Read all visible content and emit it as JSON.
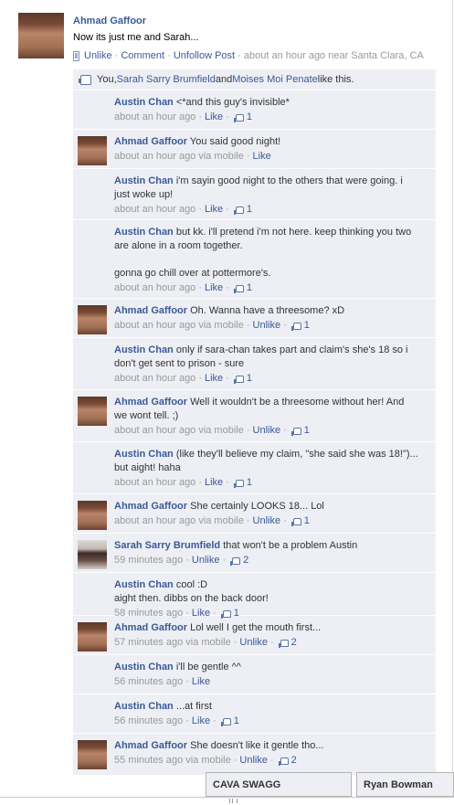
{
  "post": {
    "author": "Ahmad Gaffoor",
    "text": "Now its just me and Sarah...",
    "actions": {
      "unlike": "Unlike",
      "comment": "Comment",
      "unfollow": "Unfollow Post",
      "time": "about an hour ago near Santa Clara, CA"
    }
  },
  "likes": {
    "prefix": "You, ",
    "person1": "Sarah Sarry Brumfield",
    "and": " and ",
    "person2": "Moises Moi Penate",
    "suffix": " like this."
  },
  "comments": [
    {
      "author": "Austin Chan",
      "text": "<*and this guy's invisible*",
      "time": "about an hour ago",
      "via": "",
      "action": "Like",
      "likes": "1",
      "avatar": "none"
    },
    {
      "author": "Ahmad Gaffoor",
      "text": "You said good night!",
      "time": "about an hour ago",
      "via": "via mobile",
      "action": "Like",
      "likes": "",
      "avatar": "ahmad"
    },
    {
      "author": "Austin Chan",
      "text": "i'm sayin good night to the others that were going. i just woke up!",
      "time": "about an hour ago",
      "via": "",
      "action": "Like",
      "likes": "1",
      "avatar": "none"
    },
    {
      "author": "Austin Chan",
      "text": "but kk. i'll pretend i'm not here. keep thinking you two are alone in a room together.\n\ngonna go chill over at pottermore's.",
      "time": "about an hour ago",
      "via": "",
      "action": "Like",
      "likes": "1",
      "avatar": "none"
    },
    {
      "author": "Ahmad Gaffoor",
      "text": "Oh. Wanna have a threesome? xD",
      "time": "about an hour ago",
      "via": "via mobile",
      "action": "Unlike",
      "likes": "1",
      "avatar": "ahmad"
    },
    {
      "author": "Austin Chan",
      "text": "only if sara-chan takes part and claim's she's 18 so i don't get sent to prison - sure",
      "time": "about an hour ago",
      "via": "",
      "action": "Like",
      "likes": "1",
      "avatar": "none"
    },
    {
      "author": "Ahmad Gaffoor",
      "text": "Well it wouldn't be a threesome without her! And we wont tell. ;)",
      "time": "about an hour ago",
      "via": "via mobile",
      "action": "Unlike",
      "likes": "1",
      "avatar": "ahmad"
    },
    {
      "author": "Austin Chan",
      "text": "(like they'll believe my claim, \"she said she was 18!\")... but aight! haha",
      "time": "about an hour ago",
      "via": "",
      "action": "Like",
      "likes": "1",
      "avatar": "none"
    },
    {
      "author": "Ahmad Gaffoor",
      "text": "She certainly LOOKS 18... Lol",
      "time": "about an hour ago",
      "via": "via mobile",
      "action": "Unlike",
      "likes": "1",
      "avatar": "ahmad"
    },
    {
      "author": "Sarah Sarry Brumfield",
      "text": "that won't be a problem Austin",
      "time": "59 minutes ago",
      "via": "",
      "action": "Unlike",
      "likes": "2",
      "avatar": "sarah"
    },
    {
      "author": "Austin Chan",
      "text": "cool :D\naight then. dibbs on the back door!",
      "time": "58 minutes ago",
      "via": "",
      "action": "Like",
      "likes": "1",
      "avatar": "none"
    },
    {
      "author": "Ahmad Gaffoor",
      "text": "Lol well I get the mouth first...",
      "time": "57 minutes ago",
      "via": "via mobile",
      "action": "Unlike",
      "likes": "2",
      "avatar": "ahmad"
    },
    {
      "author": "Austin Chan",
      "text": "i'll be gentle ^^",
      "time": "56 minutes ago",
      "via": "",
      "action": "Like",
      "likes": "",
      "avatar": "none"
    },
    {
      "author": "Austin Chan",
      "text": "...at first",
      "time": "56 minutes ago",
      "via": "",
      "action": "Like",
      "likes": "1",
      "avatar": "none"
    },
    {
      "author": "Ahmad Gaffoor",
      "text": "She doesn't like it gentle tho...",
      "time": "55 minutes ago",
      "via": "via mobile",
      "action": "Unlike",
      "likes": "2",
      "avatar": "ahmad"
    }
  ],
  "chat": {
    "tab1": "CAVA SWAGG",
    "tab2": "Ryan Bowman"
  }
}
